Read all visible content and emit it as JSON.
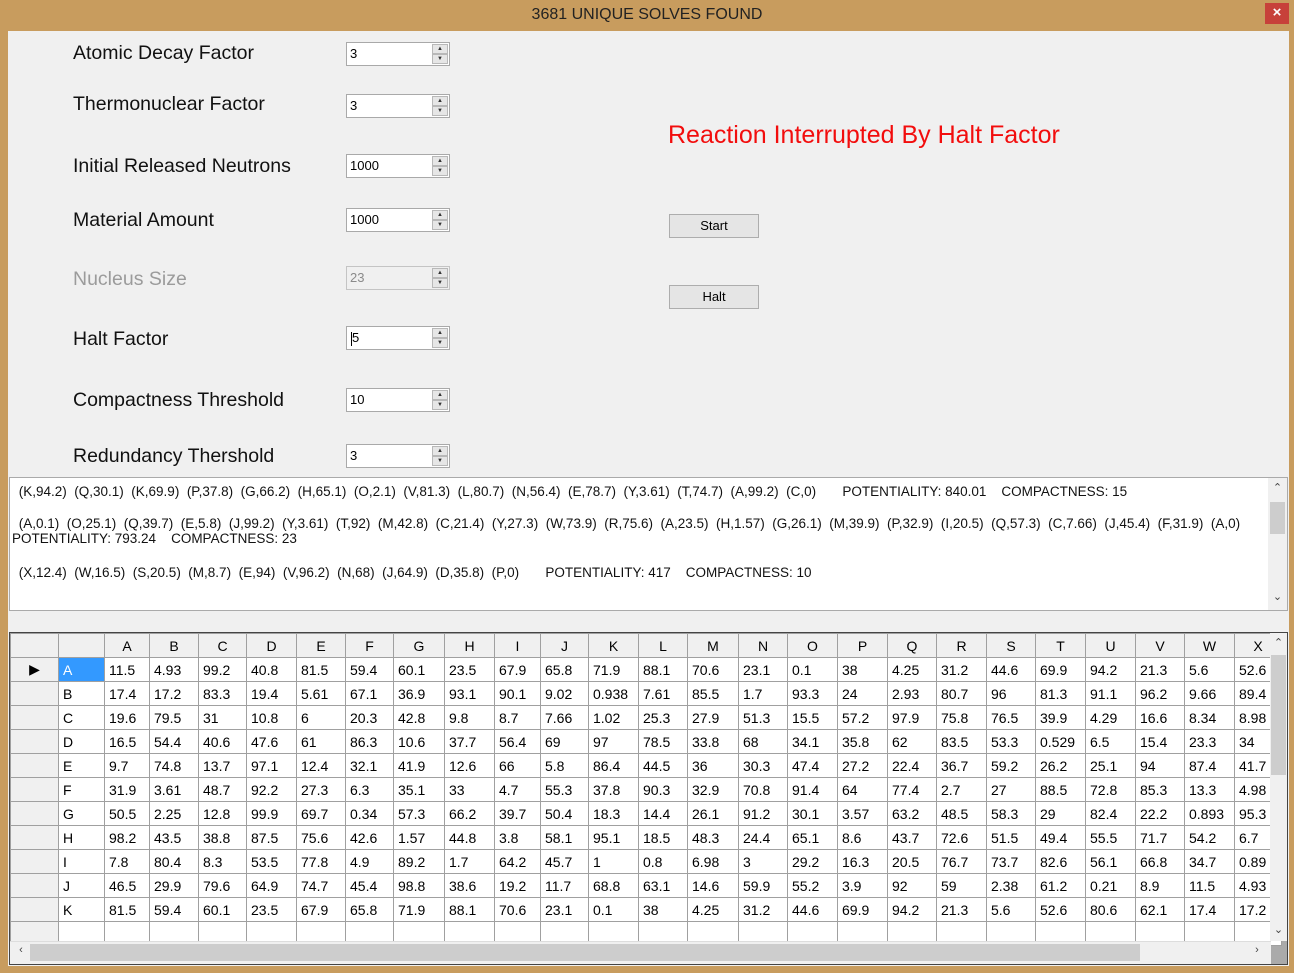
{
  "window": {
    "title": "3681 UNIQUE SOLVES FOUND",
    "close_glyph": "×"
  },
  "form": {
    "fields": [
      {
        "label": "Atomic Decay Factor",
        "value": "3",
        "enabled": true
      },
      {
        "label": "Thermonuclear Factor",
        "value": "3",
        "enabled": true
      },
      {
        "label": "Initial Released Neutrons",
        "value": "1000",
        "enabled": true
      },
      {
        "label": "Material Amount",
        "value": "1000",
        "enabled": true
      },
      {
        "label": "Nucleus Size",
        "value": "23",
        "enabled": false
      },
      {
        "label": "Halt Factor",
        "value": "5",
        "enabled": true
      },
      {
        "label": "Compactness Threshold",
        "value": "10",
        "enabled": true
      },
      {
        "label": "Redundancy Thershold",
        "value": "3",
        "enabled": true
      }
    ],
    "status": "Reaction Interrupted By Halt Factor",
    "start_label": "Start",
    "halt_label": "Halt",
    "status_color": "#f20d0d"
  },
  "results": {
    "lines": [
      " (K,94.2)  (Q,30.1)  (K,69.9)  (P,37.8)  (G,66.2)  (H,65.1)  (O,2.1)  (V,81.3)  (L,80.7)  (N,56.4)  (E,78.7)  (Y,3.61)  (T,74.7)  (A,99.2)  (C,0)       POTENTIALITY: 840.01    COMPACTNESS: 15",
      " (A,0.1)  (O,25.1)  (Q,39.7)  (E,5.8)  (J,99.2)  (Y,3.61)  (T,92)  (M,42.8)  (C,21.4)  (Y,27.3)  (W,73.9)  (R,75.6)  (A,23.5)  (H,1.57)  (G,26.1)  (M,39.9)  (P,32.9)  (I,20.5)  (Q,57.3)  (C,7.66)  (J,45.4)  (F,31.9)  (A,0)",
      "POTENTIALITY: 793.24    COMPACTNESS: 23",
      " (X,12.4)  (W,16.5)  (S,20.5)  (M,8.7)  (E,94)  (V,96.2)  (N,68)  (J,64.9)  (D,35.8)  (P,0)       POTENTIALITY: 417    COMPACTNESS: 10"
    ]
  },
  "grid": {
    "row_indicator": "▶",
    "columns": [
      "A",
      "B",
      "C",
      "D",
      "E",
      "F",
      "G",
      "H",
      "I",
      "J",
      "K",
      "L",
      "M",
      "N",
      "O",
      "P",
      "Q",
      "R",
      "S",
      "T",
      "U",
      "V",
      "W",
      "X"
    ],
    "rows": [
      {
        "label": "A",
        "cells": [
          "11.5",
          "4.93",
          "99.2",
          "40.8",
          "81.5",
          "59.4",
          "60.1",
          "23.5",
          "67.9",
          "65.8",
          "71.9",
          "88.1",
          "70.6",
          "23.1",
          "0.1",
          "38",
          "4.25",
          "31.2",
          "44.6",
          "69.9",
          "94.2",
          "21.3",
          "5.6",
          "52.6"
        ]
      },
      {
        "label": "B",
        "cells": [
          "17.4",
          "17.2",
          "83.3",
          "19.4",
          "5.61",
          "67.1",
          "36.9",
          "93.1",
          "90.1",
          "9.02",
          "0.938",
          "7.61",
          "85.5",
          "1.7",
          "93.3",
          "24",
          "2.93",
          "80.7",
          "96",
          "81.3",
          "91.1",
          "96.2",
          "9.66",
          "89.4"
        ]
      },
      {
        "label": "C",
        "cells": [
          "19.6",
          "79.5",
          "31",
          "10.8",
          "6",
          "20.3",
          "42.8",
          "9.8",
          "8.7",
          "7.66",
          "1.02",
          "25.3",
          "27.9",
          "51.3",
          "15.5",
          "57.2",
          "97.9",
          "75.8",
          "76.5",
          "39.9",
          "4.29",
          "16.6",
          "8.34",
          "8.98"
        ]
      },
      {
        "label": "D",
        "cells": [
          "16.5",
          "54.4",
          "40.6",
          "47.6",
          "61",
          "86.3",
          "10.6",
          "37.7",
          "56.4",
          "69",
          "97",
          "78.5",
          "33.8",
          "68",
          "34.1",
          "35.8",
          "62",
          "83.5",
          "53.3",
          "0.529",
          "6.5",
          "15.4",
          "23.3",
          "34"
        ]
      },
      {
        "label": "E",
        "cells": [
          "9.7",
          "74.8",
          "13.7",
          "97.1",
          "12.4",
          "32.1",
          "41.9",
          "12.6",
          "66",
          "5.8",
          "86.4",
          "44.5",
          "36",
          "30.3",
          "47.4",
          "27.2",
          "22.4",
          "36.7",
          "59.2",
          "26.2",
          "25.1",
          "94",
          "87.4",
          "41.7"
        ]
      },
      {
        "label": "F",
        "cells": [
          "31.9",
          "3.61",
          "48.7",
          "92.2",
          "27.3",
          "6.3",
          "35.1",
          "33",
          "4.7",
          "55.3",
          "37.8",
          "90.3",
          "32.9",
          "70.8",
          "91.4",
          "64",
          "77.4",
          "2.7",
          "27",
          "88.5",
          "72.8",
          "85.3",
          "13.3",
          "4.98"
        ]
      },
      {
        "label": "G",
        "cells": [
          "50.5",
          "2.25",
          "12.8",
          "99.9",
          "69.7",
          "0.34",
          "57.3",
          "66.2",
          "39.7",
          "50.4",
          "18.3",
          "14.4",
          "26.1",
          "91.2",
          "30.1",
          "3.57",
          "63.2",
          "48.5",
          "58.3",
          "29",
          "82.4",
          "22.2",
          "0.893",
          "95.3"
        ]
      },
      {
        "label": "H",
        "cells": [
          "98.2",
          "43.5",
          "38.8",
          "87.5",
          "75.6",
          "42.6",
          "1.57",
          "44.8",
          "3.8",
          "58.1",
          "95.1",
          "18.5",
          "48.3",
          "24.4",
          "65.1",
          "8.6",
          "43.7",
          "72.6",
          "51.5",
          "49.4",
          "55.5",
          "71.7",
          "54.2",
          "6.7"
        ]
      },
      {
        "label": "I",
        "cells": [
          "7.8",
          "80.4",
          "8.3",
          "53.5",
          "77.8",
          "4.9",
          "89.2",
          "1.7",
          "64.2",
          "45.7",
          "1",
          "0.8",
          "6.98",
          "3",
          "29.2",
          "16.3",
          "20.5",
          "76.7",
          "73.7",
          "82.6",
          "56.1",
          "66.8",
          "34.7",
          "0.89"
        ]
      },
      {
        "label": "J",
        "cells": [
          "46.5",
          "29.9",
          "79.6",
          "64.9",
          "74.7",
          "45.4",
          "98.8",
          "38.6",
          "19.2",
          "11.7",
          "68.8",
          "63.1",
          "14.6",
          "59.9",
          "55.2",
          "3.9",
          "92",
          "59",
          "2.38",
          "61.2",
          "0.21",
          "8.9",
          "11.5",
          "4.93"
        ]
      },
      {
        "label": "K",
        "cells": [
          "81.5",
          "59.4",
          "60.1",
          "23.5",
          "67.9",
          "65.8",
          "71.9",
          "88.1",
          "70.6",
          "23.1",
          "0.1",
          "38",
          "4.25",
          "31.2",
          "44.6",
          "69.9",
          "94.2",
          "21.3",
          "5.6",
          "52.6",
          "80.6",
          "62.1",
          "17.4",
          "17.2"
        ]
      }
    ]
  }
}
